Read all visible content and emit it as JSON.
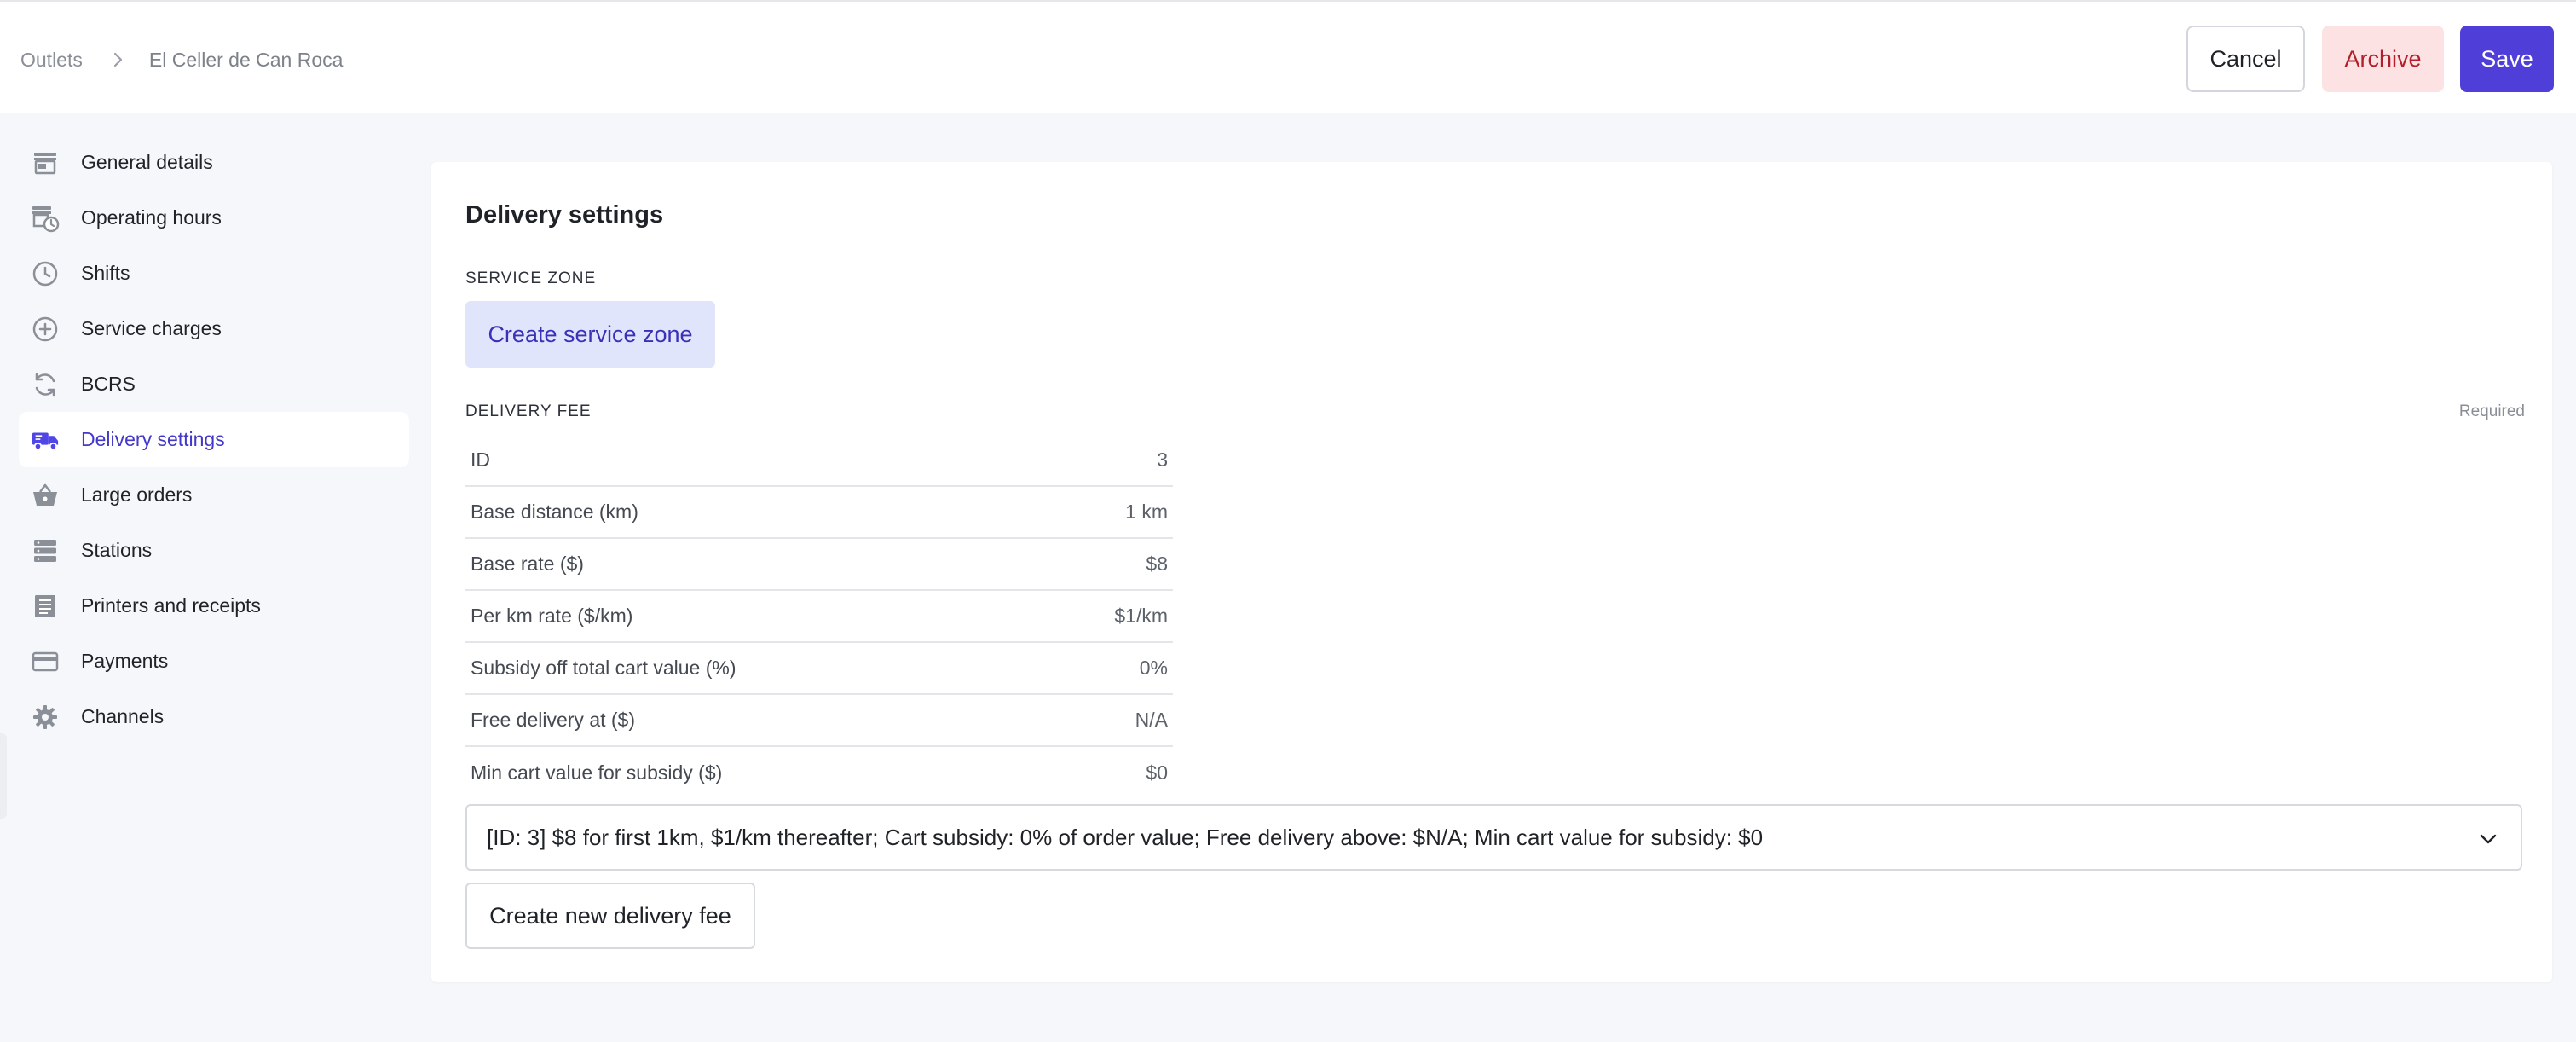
{
  "breadcrumb": {
    "root": "Outlets",
    "current": "El Celler de Can Roca"
  },
  "actions": {
    "cancel": "Cancel",
    "archive": "Archive",
    "save": "Save"
  },
  "sidebar": {
    "items": [
      {
        "label": "General details",
        "icon": "storefront-icon"
      },
      {
        "label": "Operating hours",
        "icon": "store-clock-icon"
      },
      {
        "label": "Shifts",
        "icon": "clock-icon"
      },
      {
        "label": "Service charges",
        "icon": "plus-circle-icon"
      },
      {
        "label": "BCRS",
        "icon": "refresh-icon"
      },
      {
        "label": "Delivery settings",
        "icon": "truck-icon",
        "active": true
      },
      {
        "label": "Large orders",
        "icon": "basket-icon"
      },
      {
        "label": "Stations",
        "icon": "server-icon"
      },
      {
        "label": "Printers and receipts",
        "icon": "receipt-icon"
      },
      {
        "label": "Payments",
        "icon": "credit-card-icon"
      },
      {
        "label": "Channels",
        "icon": "gear-icon"
      }
    ]
  },
  "main": {
    "title": "Delivery settings",
    "service_zone": {
      "label": "SERVICE ZONE",
      "button": "Create service zone"
    },
    "delivery_fee": {
      "label": "DELIVERY FEE",
      "required": "Required",
      "rows": [
        {
          "key": "ID",
          "value": "3"
        },
        {
          "key": "Base distance (km)",
          "value": "1 km"
        },
        {
          "key": "Base rate ($)",
          "value": "$8"
        },
        {
          "key": "Per km rate ($/km)",
          "value": "$1/km"
        },
        {
          "key": "Subsidy off total cart value (%)",
          "value": "0%"
        },
        {
          "key": "Free delivery at ($)",
          "value": "N/A"
        },
        {
          "key": "Min cart value for subsidy ($)",
          "value": "$0"
        }
      ],
      "selected": "[ID: 3] $8 for first 1km, $1/km thereafter; Cart subsidy: 0% of order value; Free delivery above: $N/A; Min cart value for subsidy: $0",
      "create_button": "Create new delivery fee"
    }
  },
  "colors": {
    "accent": "#4f3fd8",
    "archive_bg": "#fde2e4",
    "archive_text": "#b1202b",
    "zone_bg": "#e0e5fb"
  }
}
